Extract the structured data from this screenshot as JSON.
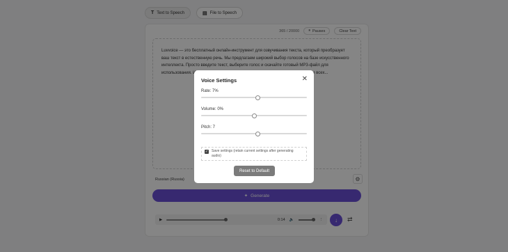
{
  "tabs": [
    {
      "label": "Text to Speech",
      "icon": "text-icon",
      "active": true
    },
    {
      "label": "File to Speech",
      "icon": "file-icon",
      "active": false
    }
  ],
  "toolbar": {
    "char_count": "365 / 20000",
    "pauses_label": "Pauses",
    "clear_label": "Clear Text"
  },
  "editor": {
    "text": "Luvvoice — это бесплатный онлайн-инструмент для озвучивания текста, который преобразует ваш текст в естественную речь. Мы предлагаем широкий выбор голосов на базе искусственного интеллекта. Просто введите текст, выберите голос и скачайте готовый MP3-файл для использования. Идеально подходит для создания аудио-контента, студентов и всех..."
  },
  "voice": {
    "language": "Russian (Russia)"
  },
  "generate_label": "Generate",
  "player": {
    "time": "0:14",
    "progress": 0.97,
    "volume": 1.0
  },
  "modal": {
    "title": "Voice Settings",
    "rate": {
      "label": "Rate: 7%",
      "value": 7,
      "range": [
        -100,
        100
      ]
    },
    "volume": {
      "label": "Volume: 0%",
      "value": 0,
      "range": [
        -100,
        100
      ]
    },
    "pitch": {
      "label": "Pitch: 7",
      "value": 7,
      "range": [
        -100,
        100
      ]
    },
    "save_label": "Save settings (retain current settings after generating audio)",
    "save_checked": true,
    "reset_label": "Reset to Default"
  },
  "colors": {
    "accent": "#6a4fd6",
    "overlay": "rgba(0,0,0,0.48)"
  }
}
